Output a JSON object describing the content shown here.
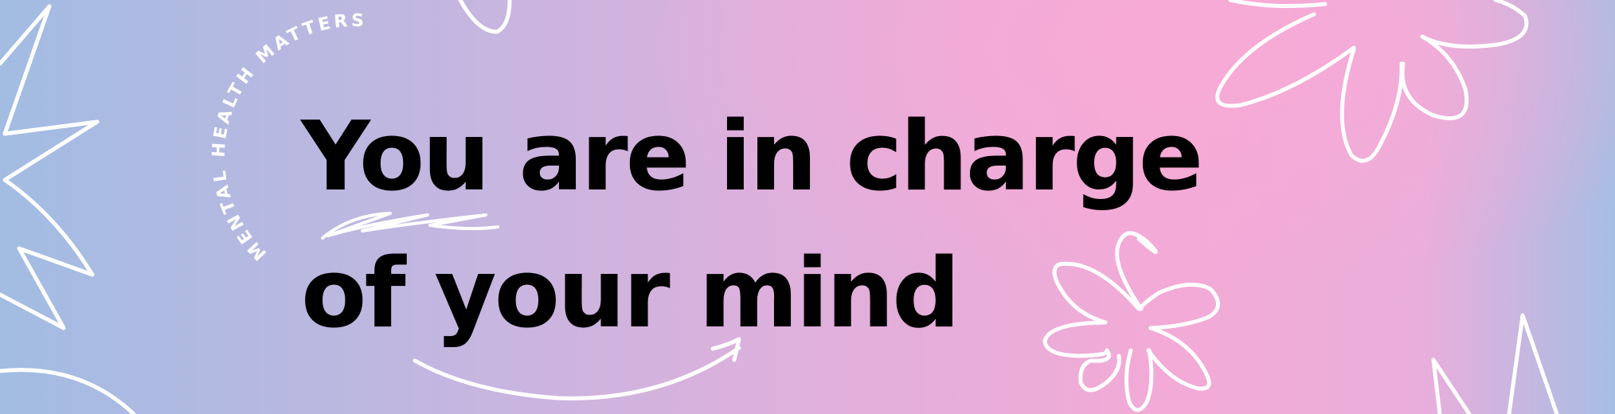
{
  "badge": {
    "arc_text": "MENTAL HEALTH MATTERS"
  },
  "headline": {
    "line1": "You are in charge",
    "line2": "of your mind"
  },
  "colors": {
    "text": "#000000",
    "doodle": "#ffffff",
    "gradient_left": "#a2bce2",
    "gradient_center": "#f3aad6",
    "gradient_right": "#a6bee4"
  },
  "decorations": [
    "zigzag-doodle",
    "flower-doodle",
    "arrow-doodle",
    "squiggle-doodle",
    "circle-arc-doodle"
  ]
}
